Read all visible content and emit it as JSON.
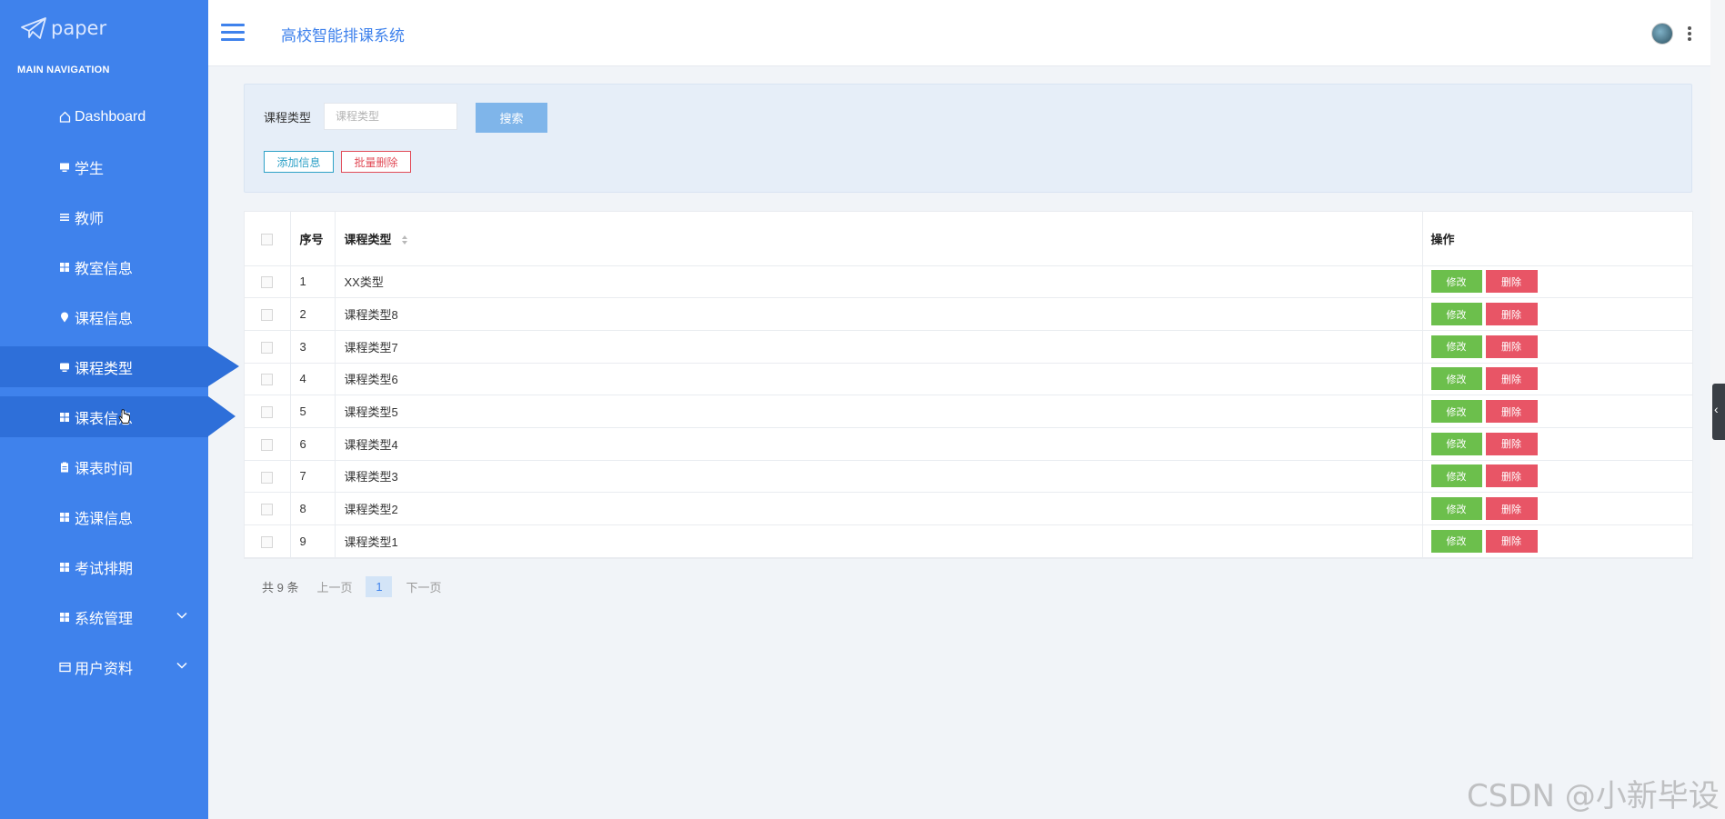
{
  "brand": {
    "name": "paper"
  },
  "nav": {
    "header": "MAIN NAVIGATION",
    "items": [
      {
        "label": "Dashboard",
        "icon": "home-icon"
      },
      {
        "label": "学生",
        "icon": "monitor-icon"
      },
      {
        "label": "教师",
        "icon": "list-icon"
      },
      {
        "label": "教室信息",
        "icon": "grid-icon"
      },
      {
        "label": "课程信息",
        "icon": "pin-icon"
      },
      {
        "label": "课程类型",
        "icon": "monitor-icon"
      },
      {
        "label": "课表信息",
        "icon": "grid-icon"
      },
      {
        "label": "课表时间",
        "icon": "clipboard-icon"
      },
      {
        "label": "选课信息",
        "icon": "grid-icon"
      },
      {
        "label": "考试排期",
        "icon": "grid-icon"
      },
      {
        "label": "系统管理",
        "icon": "grid-icon"
      },
      {
        "label": "用户资料",
        "icon": "card-icon"
      }
    ]
  },
  "topbar": {
    "title": "高校智能排课系统"
  },
  "search": {
    "label": "课程类型",
    "placeholder": "课程类型",
    "button": "搜索",
    "add_button": "添加信息",
    "batch_delete_button": "批量删除"
  },
  "table": {
    "headers": {
      "no": "序号",
      "type": "课程类型",
      "actions": "操作"
    },
    "rows": [
      {
        "no": "1",
        "type": "XX类型"
      },
      {
        "no": "2",
        "type": "课程类型8"
      },
      {
        "no": "3",
        "type": "课程类型7"
      },
      {
        "no": "4",
        "type": "课程类型6"
      },
      {
        "no": "5",
        "type": "课程类型5"
      },
      {
        "no": "6",
        "type": "课程类型4"
      },
      {
        "no": "7",
        "type": "课程类型3"
      },
      {
        "no": "8",
        "type": "课程类型2"
      },
      {
        "no": "9",
        "type": "课程类型1"
      }
    ],
    "edit_label": "修改",
    "delete_label": "删除"
  },
  "pagination": {
    "total": "共 9 条",
    "prev": "上一页",
    "page": "1",
    "next": "下一页"
  },
  "watermark": "CSDN @小新毕设",
  "colors": {
    "sidebar": "#3f82ec",
    "accent": "#3f82ec",
    "edit": "#6cbf4c",
    "delete": "#e85566"
  }
}
